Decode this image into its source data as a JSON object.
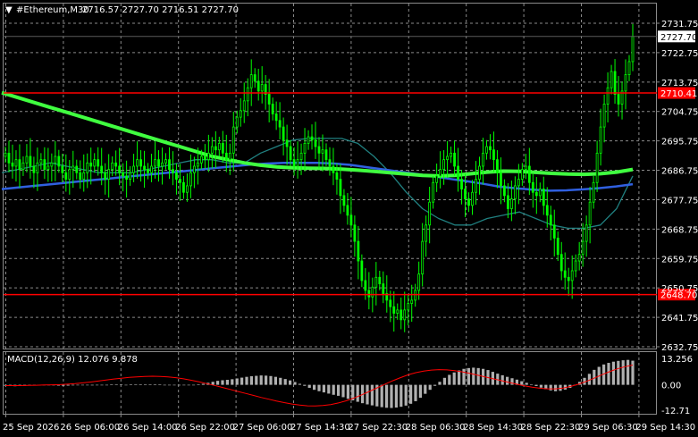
{
  "header": {
    "symbol_label": "#Ethereum,M30",
    "ohlc_label": "2716.57 2727.70 2716.51 2727.70"
  },
  "colors": {
    "background": "#000000",
    "grid": "#8a8a8a",
    "bull_candle": "#00ff00",
    "level_line": "#ff0000",
    "ma_fast": "#3060e0",
    "ma_mid": "#208080",
    "ma_slow": "#40ff40",
    "macd_hist": "#b0b0b0",
    "macd_signal": "#ff0000",
    "price_tag_bg": "#ffffff",
    "level_tag_bg": "#ff0000"
  },
  "chart_data": [
    {
      "type": "candlestick",
      "title": "#Ethereum,M30",
      "ylim": [
        2632.75,
        2731.75
      ],
      "y_ticks": [
        "2731.75",
        "2722.75",
        "2713.75",
        "2704.75",
        "2695.75",
        "2686.75",
        "2677.75",
        "2668.75",
        "2659.75",
        "2650.75",
        "2641.75",
        "2632.75"
      ],
      "x_ticks": [
        "25 Sep 2026",
        "26 Sep 06:00",
        "26 Sep 14:00",
        "26 Sep 22:00",
        "27 Sep 06:00",
        "27 Sep 14:30",
        "27 Sep 22:30",
        "28 Sep 06:30",
        "28 Sep 14:30",
        "28 Sep 22:30",
        "29 Sep 06:30",
        "29 Sep 14:30"
      ],
      "current_price": "2727.70",
      "levels": [
        {
          "value": 2710.41,
          "label": "2710.41"
        },
        {
          "value": 2648.7,
          "label": "2648.70"
        }
      ],
      "close_series": [
        2692,
        2689,
        2688,
        2690,
        2687,
        2689,
        2691,
        2688,
        2686,
        2689,
        2690,
        2687,
        2688,
        2689,
        2691,
        2688,
        2686,
        2684,
        2687,
        2688,
        2686,
        2684,
        2686,
        2689,
        2688,
        2690,
        2688,
        2686,
        2684,
        2687,
        2689,
        2688,
        2686,
        2685,
        2684,
        2686,
        2688,
        2690,
        2688,
        2687,
        2686,
        2688,
        2690,
        2688,
        2689,
        2690,
        2687,
        2686,
        2684,
        2683,
        2680,
        2682,
        2686,
        2688,
        2689,
        2691,
        2690,
        2692,
        2694,
        2693,
        2695,
        2692,
        2690,
        2692,
        2700,
        2703,
        2705,
        2708,
        2712,
        2716,
        2714,
        2711,
        2713,
        2710,
        2707,
        2704,
        2702,
        2700,
        2696,
        2694,
        2690,
        2688,
        2690,
        2692,
        2695,
        2697,
        2696,
        2694,
        2692,
        2693,
        2690,
        2688,
        2686,
        2684,
        2679,
        2676,
        2673,
        2670,
        2665,
        2659,
        2653,
        2650,
        2648,
        2651,
        2654,
        2652,
        2649,
        2647,
        2645,
        2643,
        2644,
        2641,
        2644,
        2646,
        2647,
        2650,
        2655,
        2665,
        2670,
        2677,
        2683,
        2685,
        2687,
        2690,
        2691,
        2692,
        2688,
        2684,
        2681,
        2678,
        2676,
        2680,
        2684,
        2688,
        2692,
        2694,
        2693,
        2690,
        2686,
        2682,
        2679,
        2675,
        2678,
        2682,
        2684,
        2687,
        2688,
        2683,
        2680,
        2679,
        2681,
        2676,
        2673,
        2670,
        2666,
        2661,
        2656,
        2654,
        2653,
        2656,
        2659,
        2661,
        2665,
        2670,
        2677,
        2683,
        2692,
        2700,
        2707,
        2712,
        2717,
        2710,
        2707,
        2711,
        2716,
        2720,
        2727.7
      ],
      "series": [
        {
          "name": "MA fast",
          "values": [
            2681,
            2681.5,
            2682,
            2682.5,
            2683,
            2683.5,
            2684,
            2684.5,
            2685,
            2685.5,
            2686,
            2686.5,
            2687,
            2687.5,
            2688,
            2688.5,
            2688.8,
            2689,
            2689,
            2689,
            2688.8,
            2688.4,
            2687.7,
            2687,
            2686.3,
            2685.6,
            2684.9,
            2684.1,
            2683.4,
            2682.6,
            2681.7,
            2681.2,
            2680.8,
            2680.5,
            2680.6,
            2680.9,
            2681.3,
            2681.8,
            2682.5
          ]
        },
        {
          "name": "MA mid",
          "values": [
            2686,
            2687,
            2688,
            2689,
            2688,
            2687,
            2686,
            2686,
            2686,
            2687,
            2688,
            2689,
            2690,
            2690,
            2689,
            2689,
            2692,
            2694,
            2696,
            2696.5,
            2696.5,
            2696.5,
            2695,
            2691,
            2686,
            2680,
            2675,
            2672,
            2670,
            2670,
            2672,
            2673,
            2674,
            2672,
            2670,
            2669,
            2669,
            2670,
            2675,
            2685
          ]
        },
        {
          "name": "MA slow",
          "values": [
            2710.5,
            2709,
            2707.5,
            2706,
            2704.5,
            2703,
            2701.5,
            2700,
            2698.5,
            2697,
            2695.5,
            2694,
            2692.5,
            2691,
            2690,
            2689,
            2688.3,
            2687.8,
            2687.5,
            2687.4,
            2687.3,
            2687.1,
            2686.8,
            2686.4,
            2686,
            2685.6,
            2685.2,
            2685,
            2685.2,
            2685.7,
            2686.2,
            2686.5,
            2686.4,
            2686.1,
            2685.8,
            2685.6,
            2685.5,
            2685.7,
            2686.2,
            2687
          ]
        }
      ]
    },
    {
      "type": "bar",
      "title": "MACD(12,26,9) 12.076 9.878",
      "ylim": [
        -12.71,
        13.256
      ],
      "y_ticks": [
        "13.256",
        "0.00",
        "-12.71"
      ],
      "values": [
        -0.5,
        -0.6,
        -0.7,
        -0.6,
        -0.5,
        -0.4,
        -0.3,
        -0.3,
        -0.2,
        -0.2,
        -0.3,
        -0.4,
        -0.5,
        -0.4,
        -0.3,
        -0.2,
        -0.1,
        -0.2,
        -0.3,
        -0.2,
        -0.1,
        0.0,
        0.1,
        0.2,
        0.1,
        0.0,
        0.1,
        0.2,
        0.3,
        0.2,
        0.1,
        0.2,
        0.1,
        0.0,
        -0.1,
        -0.2,
        -0.3,
        -0.2,
        -0.1,
        0.0,
        0.2,
        0.5,
        1.0,
        1.5,
        2.0,
        2.3,
        2.5,
        2.8,
        3.2,
        3.6,
        4.0,
        4.3,
        4.5,
        4.7,
        4.6,
        4.4,
        4.0,
        3.5,
        2.9,
        2.2,
        1.4,
        0.5,
        -0.5,
        -1.5,
        -2.5,
        -3.2,
        -3.8,
        -4.4,
        -5.0,
        -5.5,
        -6.2,
        -7.0,
        -7.8,
        -8.5,
        -9.2,
        -9.8,
        -10.3,
        -10.8,
        -11.2,
        -11.5,
        -11.6,
        -11.4,
        -11.0,
        -10.4,
        -9.5,
        -8.2,
        -6.5,
        -4.5,
        -2.5,
        -0.5,
        1.5,
        3.5,
        5.0,
        6.2,
        7.2,
        8.0,
        8.4,
        8.6,
        8.4,
        8.0,
        7.4,
        6.5,
        5.6,
        4.8,
        4.0,
        3.3,
        2.6,
        1.8,
        1.0,
        0.2,
        -0.6,
        -1.4,
        -2.2,
        -2.8,
        -3.2,
        -3.0,
        -2.4,
        -1.5,
        -0.2,
        1.5,
        3.5,
        5.5,
        7.5,
        9.0,
        10.2,
        11.0,
        11.6,
        12.0,
        12.3,
        12.5,
        12.1
      ],
      "signal": [
        -0.4,
        -0.4,
        -0.4,
        -0.3,
        -0.2,
        -0.1,
        0.0,
        0.1,
        0.3,
        0.6,
        1.0,
        1.4,
        1.9,
        2.4,
        2.9,
        3.3,
        3.7,
        4.0,
        4.2,
        4.3,
        4.2,
        4.0,
        3.6,
        3.0,
        2.3,
        1.5,
        0.6,
        -0.3,
        -1.3,
        -2.3,
        -3.3,
        -4.3,
        -5.3,
        -6.3,
        -7.2,
        -8.1,
        -8.9,
        -9.6,
        -10.1,
        -10.5,
        -10.6,
        -10.4,
        -9.9,
        -9.1,
        -8.0,
        -6.6,
        -5.0,
        -3.3,
        -1.5,
        0.3,
        2.0,
        3.6,
        5.0,
        6.1,
        6.9,
        7.4,
        7.6,
        7.5,
        7.1,
        6.5,
        5.7,
        4.8,
        3.9,
        3.0,
        2.1,
        1.2,
        0.3,
        -0.5,
        -1.2,
        -1.7,
        -2.0,
        -2.0,
        -1.6,
        -0.8,
        0.3,
        1.7,
        3.3,
        5.0,
        6.6,
        8.0,
        9.1,
        9.9
      ]
    }
  ]
}
